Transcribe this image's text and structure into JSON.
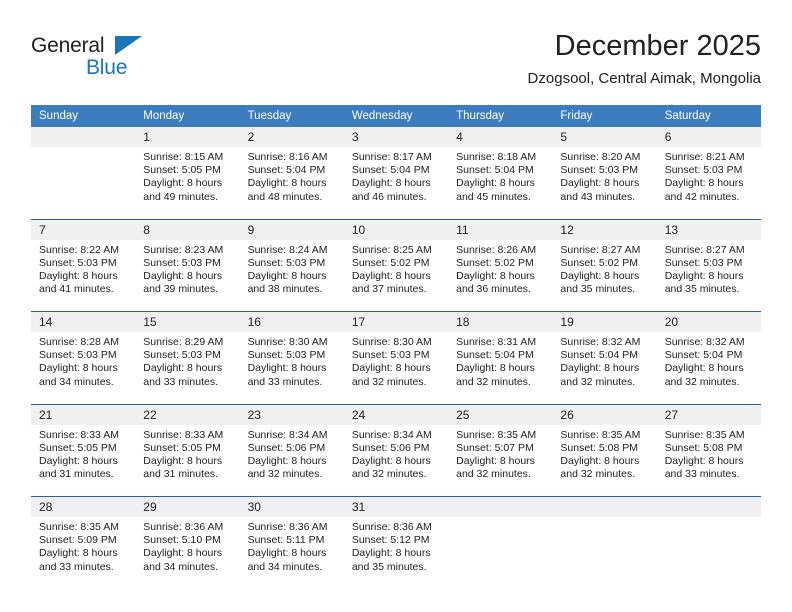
{
  "brand": {
    "name_top": "General",
    "name_bottom": "Blue",
    "accent_color": "#1b75bb"
  },
  "header": {
    "title": "December 2025",
    "location": "Dzogsool, Central Aimak, Mongolia"
  },
  "calendar": {
    "header_bg": "#3b7dbf",
    "separator_color": "#2c5f9e",
    "daynum_bg": "#f0f0f0",
    "weekday_headers": [
      "Sunday",
      "Monday",
      "Tuesday",
      "Wednesday",
      "Thursday",
      "Friday",
      "Saturday"
    ],
    "weeks": [
      [
        {
          "day": "",
          "lines": [
            "",
            "",
            "",
            ""
          ]
        },
        {
          "day": "1",
          "lines": [
            "Sunrise: 8:15 AM",
            "Sunset: 5:05 PM",
            "Daylight: 8 hours",
            "and 49 minutes."
          ]
        },
        {
          "day": "2",
          "lines": [
            "Sunrise: 8:16 AM",
            "Sunset: 5:04 PM",
            "Daylight: 8 hours",
            "and 48 minutes."
          ]
        },
        {
          "day": "3",
          "lines": [
            "Sunrise: 8:17 AM",
            "Sunset: 5:04 PM",
            "Daylight: 8 hours",
            "and 46 minutes."
          ]
        },
        {
          "day": "4",
          "lines": [
            "Sunrise: 8:18 AM",
            "Sunset: 5:04 PM",
            "Daylight: 8 hours",
            "and 45 minutes."
          ]
        },
        {
          "day": "5",
          "lines": [
            "Sunrise: 8:20 AM",
            "Sunset: 5:03 PM",
            "Daylight: 8 hours",
            "and 43 minutes."
          ]
        },
        {
          "day": "6",
          "lines": [
            "Sunrise: 8:21 AM",
            "Sunset: 5:03 PM",
            "Daylight: 8 hours",
            "and 42 minutes."
          ]
        }
      ],
      [
        {
          "day": "7",
          "lines": [
            "Sunrise: 8:22 AM",
            "Sunset: 5:03 PM",
            "Daylight: 8 hours",
            "and 41 minutes."
          ]
        },
        {
          "day": "8",
          "lines": [
            "Sunrise: 8:23 AM",
            "Sunset: 5:03 PM",
            "Daylight: 8 hours",
            "and 39 minutes."
          ]
        },
        {
          "day": "9",
          "lines": [
            "Sunrise: 8:24 AM",
            "Sunset: 5:03 PM",
            "Daylight: 8 hours",
            "and 38 minutes."
          ]
        },
        {
          "day": "10",
          "lines": [
            "Sunrise: 8:25 AM",
            "Sunset: 5:02 PM",
            "Daylight: 8 hours",
            "and 37 minutes."
          ]
        },
        {
          "day": "11",
          "lines": [
            "Sunrise: 8:26 AM",
            "Sunset: 5:02 PM",
            "Daylight: 8 hours",
            "and 36 minutes."
          ]
        },
        {
          "day": "12",
          "lines": [
            "Sunrise: 8:27 AM",
            "Sunset: 5:02 PM",
            "Daylight: 8 hours",
            "and 35 minutes."
          ]
        },
        {
          "day": "13",
          "lines": [
            "Sunrise: 8:27 AM",
            "Sunset: 5:03 PM",
            "Daylight: 8 hours",
            "and 35 minutes."
          ]
        }
      ],
      [
        {
          "day": "14",
          "lines": [
            "Sunrise: 8:28 AM",
            "Sunset: 5:03 PM",
            "Daylight: 8 hours",
            "and 34 minutes."
          ]
        },
        {
          "day": "15",
          "lines": [
            "Sunrise: 8:29 AM",
            "Sunset: 5:03 PM",
            "Daylight: 8 hours",
            "and 33 minutes."
          ]
        },
        {
          "day": "16",
          "lines": [
            "Sunrise: 8:30 AM",
            "Sunset: 5:03 PM",
            "Daylight: 8 hours",
            "and 33 minutes."
          ]
        },
        {
          "day": "17",
          "lines": [
            "Sunrise: 8:30 AM",
            "Sunset: 5:03 PM",
            "Daylight: 8 hours",
            "and 32 minutes."
          ]
        },
        {
          "day": "18",
          "lines": [
            "Sunrise: 8:31 AM",
            "Sunset: 5:04 PM",
            "Daylight: 8 hours",
            "and 32 minutes."
          ]
        },
        {
          "day": "19",
          "lines": [
            "Sunrise: 8:32 AM",
            "Sunset: 5:04 PM",
            "Daylight: 8 hours",
            "and 32 minutes."
          ]
        },
        {
          "day": "20",
          "lines": [
            "Sunrise: 8:32 AM",
            "Sunset: 5:04 PM",
            "Daylight: 8 hours",
            "and 32 minutes."
          ]
        }
      ],
      [
        {
          "day": "21",
          "lines": [
            "Sunrise: 8:33 AM",
            "Sunset: 5:05 PM",
            "Daylight: 8 hours",
            "and 31 minutes."
          ]
        },
        {
          "day": "22",
          "lines": [
            "Sunrise: 8:33 AM",
            "Sunset: 5:05 PM",
            "Daylight: 8 hours",
            "and 31 minutes."
          ]
        },
        {
          "day": "23",
          "lines": [
            "Sunrise: 8:34 AM",
            "Sunset: 5:06 PM",
            "Daylight: 8 hours",
            "and 32 minutes."
          ]
        },
        {
          "day": "24",
          "lines": [
            "Sunrise: 8:34 AM",
            "Sunset: 5:06 PM",
            "Daylight: 8 hours",
            "and 32 minutes."
          ]
        },
        {
          "day": "25",
          "lines": [
            "Sunrise: 8:35 AM",
            "Sunset: 5:07 PM",
            "Daylight: 8 hours",
            "and 32 minutes."
          ]
        },
        {
          "day": "26",
          "lines": [
            "Sunrise: 8:35 AM",
            "Sunset: 5:08 PM",
            "Daylight: 8 hours",
            "and 32 minutes."
          ]
        },
        {
          "day": "27",
          "lines": [
            "Sunrise: 8:35 AM",
            "Sunset: 5:08 PM",
            "Daylight: 8 hours",
            "and 33 minutes."
          ]
        }
      ],
      [
        {
          "day": "28",
          "lines": [
            "Sunrise: 8:35 AM",
            "Sunset: 5:09 PM",
            "Daylight: 8 hours",
            "and 33 minutes."
          ]
        },
        {
          "day": "29",
          "lines": [
            "Sunrise: 8:36 AM",
            "Sunset: 5:10 PM",
            "Daylight: 8 hours",
            "and 34 minutes."
          ]
        },
        {
          "day": "30",
          "lines": [
            "Sunrise: 8:36 AM",
            "Sunset: 5:11 PM",
            "Daylight: 8 hours",
            "and 34 minutes."
          ]
        },
        {
          "day": "31",
          "lines": [
            "Sunrise: 8:36 AM",
            "Sunset: 5:12 PM",
            "Daylight: 8 hours",
            "and 35 minutes."
          ]
        },
        {
          "day": "",
          "lines": [
            "",
            "",
            "",
            ""
          ]
        },
        {
          "day": "",
          "lines": [
            "",
            "",
            "",
            ""
          ]
        },
        {
          "day": "",
          "lines": [
            "",
            "",
            "",
            ""
          ]
        }
      ]
    ]
  }
}
